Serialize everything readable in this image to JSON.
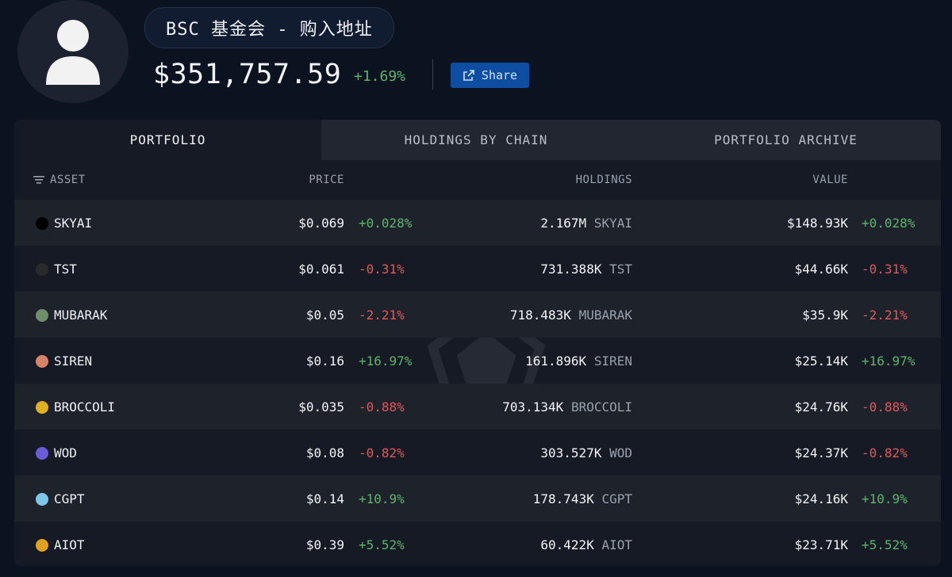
{
  "header": {
    "title": "BSC 基金会 - 购入地址",
    "total_value": "$351,757.59",
    "total_change": "+1.69%",
    "share_label": "Share"
  },
  "tabs": [
    {
      "label": "PORTFOLIO",
      "active": true
    },
    {
      "label": "HOLDINGS BY CHAIN",
      "active": false
    },
    {
      "label": "PORTFOLIO ARCHIVE",
      "active": false
    }
  ],
  "columns": {
    "asset": "ASSET",
    "price": "PRICE",
    "holdings": "HOLDINGS",
    "value": "VALUE"
  },
  "rows": [
    {
      "symbol": "SKYAI",
      "icon_color": "#000000",
      "price": "$0.069",
      "price_change": "+0.028%",
      "holdings_amount": "2.167M",
      "holdings_symbol": "SKYAI",
      "value": "$148.93K",
      "value_change": "+0.028%"
    },
    {
      "symbol": "TST",
      "icon_color": "#2a2a2a",
      "price": "$0.061",
      "price_change": "-0.31%",
      "holdings_amount": "731.388K",
      "holdings_symbol": "TST",
      "value": "$44.66K",
      "value_change": "-0.31%"
    },
    {
      "symbol": "MUBARAK",
      "icon_color": "#6f8f6a",
      "price": "$0.05",
      "price_change": "-2.21%",
      "holdings_amount": "718.483K",
      "holdings_symbol": "MUBARAK",
      "value": "$35.9K",
      "value_change": "-2.21%"
    },
    {
      "symbol": "SIREN",
      "icon_color": "#d9826a",
      "price": "$0.16",
      "price_change": "+16.97%",
      "holdings_amount": "161.896K",
      "holdings_symbol": "SIREN",
      "value": "$25.14K",
      "value_change": "+16.97%"
    },
    {
      "symbol": "BROCCOLI",
      "icon_color": "#e0b021",
      "price": "$0.035",
      "price_change": "-0.88%",
      "holdings_amount": "703.134K",
      "holdings_symbol": "BROCCOLI",
      "value": "$24.76K",
      "value_change": "-0.88%"
    },
    {
      "symbol": "WOD",
      "icon_color": "#6a5bd9",
      "price": "$0.08",
      "price_change": "-0.82%",
      "holdings_amount": "303.527K",
      "holdings_symbol": "WOD",
      "value": "$24.37K",
      "value_change": "-0.82%"
    },
    {
      "symbol": "CGPT",
      "icon_color": "#7ec6e8",
      "price": "$0.14",
      "price_change": "+10.9%",
      "holdings_amount": "178.743K",
      "holdings_symbol": "CGPT",
      "value": "$24.16K",
      "value_change": "+10.9%"
    },
    {
      "symbol": "AIOT",
      "icon_color": "#e0a020",
      "price": "$0.39",
      "price_change": "+5.52%",
      "holdings_amount": "60.422K",
      "holdings_symbol": "AIOT",
      "value": "$23.71K",
      "value_change": "+5.52%"
    }
  ]
}
